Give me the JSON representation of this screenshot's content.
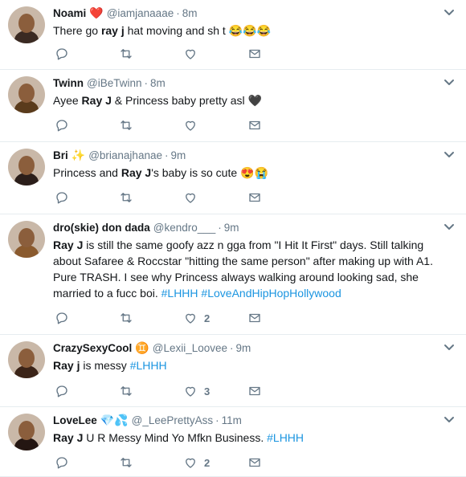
{
  "tweets": [
    {
      "name": "Noami",
      "badge": "❤️",
      "handle": "@iamjanaaae",
      "time": "8m",
      "text": [
        {
          "t": "There go ",
          "s": "n"
        },
        {
          "t": "ray j",
          "s": "b"
        },
        {
          "t": " hat moving and sh t ",
          "s": "n"
        },
        {
          "t": "😂😂😂",
          "s": "e"
        }
      ],
      "reply_count": "",
      "retweet_count": "",
      "like_count": "",
      "avatar_color": "#3a2a22"
    },
    {
      "name": "Twinn",
      "badge": "",
      "handle": "@iBeTwinn",
      "time": "8m",
      "text": [
        {
          "t": "Ayee ",
          "s": "n"
        },
        {
          "t": "Ray J",
          "s": "b"
        },
        {
          "t": " & Princess baby pretty asl ",
          "s": "n"
        },
        {
          "t": "🖤",
          "s": "e"
        }
      ],
      "reply_count": "",
      "retweet_count": "",
      "like_count": "",
      "avatar_color": "#5a3b1c"
    },
    {
      "name": "Bri",
      "badge": "✨",
      "handle": "@brianajhanae",
      "time": "9m",
      "text": [
        {
          "t": "Princess and ",
          "s": "n"
        },
        {
          "t": "Ray J",
          "s": "b"
        },
        {
          "t": "'s baby is so cute ",
          "s": "n"
        },
        {
          "t": "😍😭",
          "s": "e"
        }
      ],
      "reply_count": "",
      "retweet_count": "",
      "like_count": "",
      "avatar_color": "#2b1e1a"
    },
    {
      "name": "dro(skie) don dada",
      "badge": "",
      "handle": "@kendro___",
      "time": "9m",
      "text": [
        {
          "t": "Ray J",
          "s": "b"
        },
        {
          "t": " is still the same goofy azz n gga from \"I Hit It First\" days. Still talking about Safaree & Roccstar \"hitting the same person\" after making up with A1. Pure TRASH. I see why Princess always walking around looking sad, she married to a fucc boi. ",
          "s": "n"
        },
        {
          "t": "#LHHH",
          "s": "h"
        },
        {
          "t": " ",
          "s": "n"
        },
        {
          "t": "#LoveAndHipHopHollywood",
          "s": "h"
        }
      ],
      "reply_count": "",
      "retweet_count": "",
      "like_count": "2",
      "avatar_color": "#8a5a2e"
    },
    {
      "name": "CrazySexyCool",
      "badge": "♊",
      "handle": "@Lexii_Loovee",
      "time": "9m",
      "text": [
        {
          "t": "Ray j",
          "s": "b"
        },
        {
          "t": " is messy ",
          "s": "n"
        },
        {
          "t": "#LHHH",
          "s": "h"
        }
      ],
      "reply_count": "",
      "retweet_count": "",
      "like_count": "3",
      "avatar_color": "#3b2418"
    },
    {
      "name": "LoveLee",
      "badge": "💎💦",
      "handle": "@_LeePrettyAss",
      "time": "11m",
      "text": [
        {
          "t": "Ray J",
          "s": "b"
        },
        {
          "t": " U R Messy Mind Yo Mfkn Business.  ",
          "s": "n"
        },
        {
          "t": "#LHHH",
          "s": "h"
        }
      ],
      "reply_count": "",
      "retweet_count": "",
      "like_count": "2",
      "avatar_color": "#241612"
    }
  ],
  "icons": {
    "reply": "reply-icon",
    "retweet": "retweet-icon",
    "like": "like-icon",
    "dm": "direct-message-icon",
    "caret": "chevron-down-icon"
  },
  "colors": {
    "text": "#14171a",
    "muted": "#657786",
    "link": "#1b95e0",
    "divider": "#e6ecf0"
  }
}
